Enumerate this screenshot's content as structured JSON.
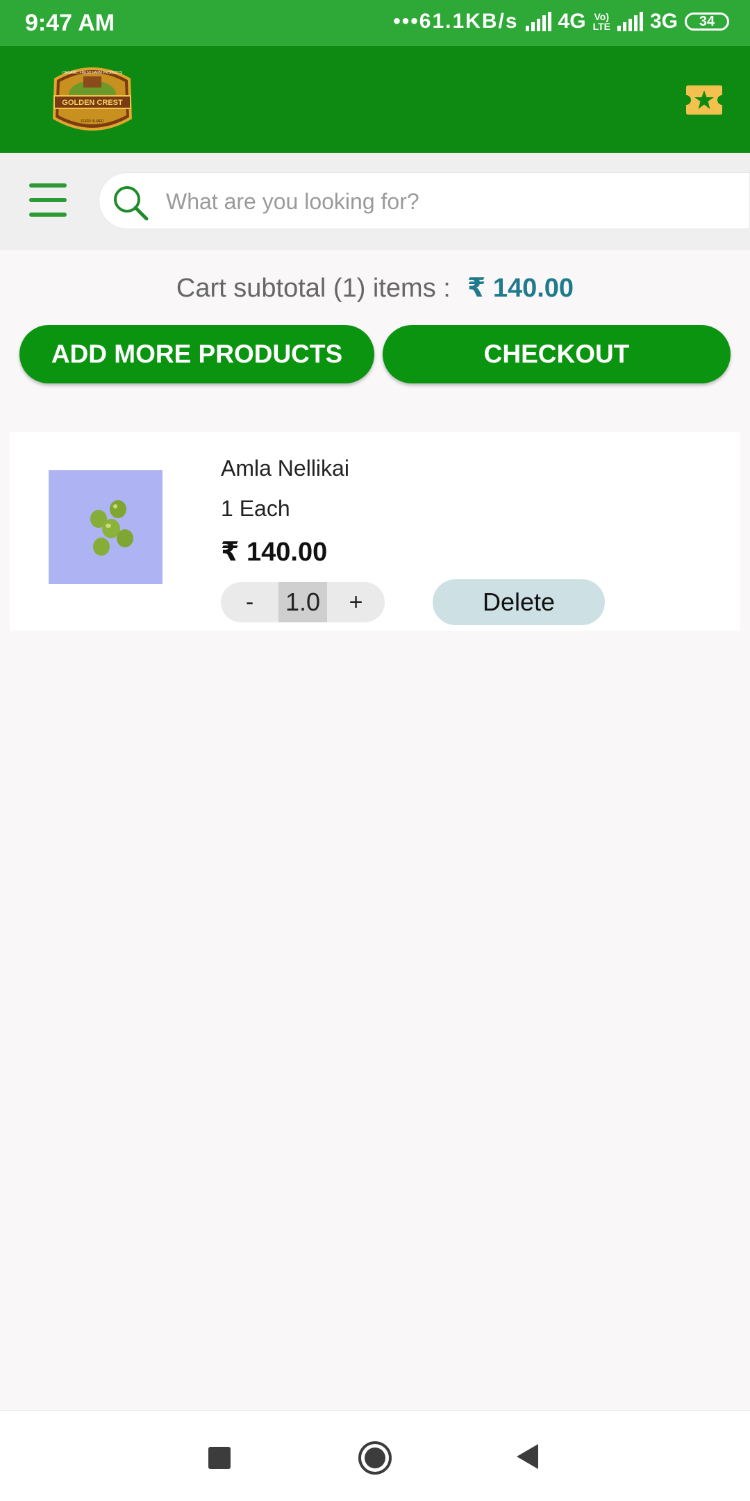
{
  "status_bar": {
    "time": "9:47 AM",
    "network_speed": "•••61.1KB/s",
    "network_1": "4G",
    "volte_top": "Vo)",
    "volte_bottom": "LTE",
    "network_2": "3G",
    "battery": "34"
  },
  "header": {
    "logo_text": "GOLDEN CREST",
    "logo_top_text": "ORGANIC FRESH FARM PRODUCTS",
    "logo_bottom_text": "FOOD IS MED",
    "colors": {
      "bar": "#0e8a13",
      "status": "#2ea837"
    },
    "action_icon": "ticket-star-icon"
  },
  "search": {
    "placeholder": "What are you looking for?",
    "value": ""
  },
  "cart": {
    "subtotal_label": "Cart subtotal (1) items :",
    "subtotal_amount": "₹ 140.00",
    "add_more_label": "ADD MORE PRODUCTS",
    "checkout_label": "CHECKOUT",
    "items": [
      {
        "name": "Amla Nellikai",
        "unit": "1 Each",
        "price": "₹ 140.00",
        "minus": "-",
        "quantity": "1.0",
        "plus": "+",
        "delete_label": "Delete"
      }
    ]
  },
  "nav": {
    "recents_icon": "square-icon",
    "home_icon": "circle-home-icon",
    "back_icon": "triangle-back-icon"
  }
}
